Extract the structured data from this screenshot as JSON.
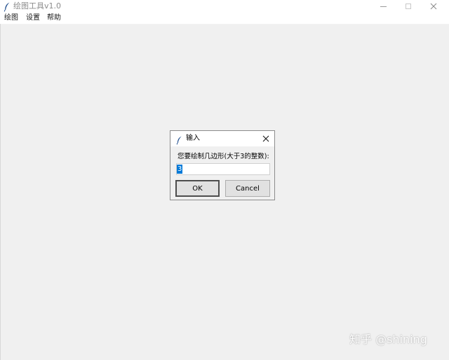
{
  "window": {
    "title": "绘图工具v1.0",
    "icon": "feather-icon"
  },
  "menubar": {
    "items": [
      {
        "label": "绘图"
      },
      {
        "label": "设置"
      },
      {
        "label": "帮助"
      }
    ]
  },
  "dialog": {
    "title": "输入",
    "icon": "feather-icon",
    "prompt": "您要绘制几边形(大于3的整数):",
    "entry_value": "3",
    "ok_label": "OK",
    "cancel_label": "Cancel",
    "selection_color": "#0078d7"
  },
  "watermark": {
    "text": "知乎 @shining"
  }
}
